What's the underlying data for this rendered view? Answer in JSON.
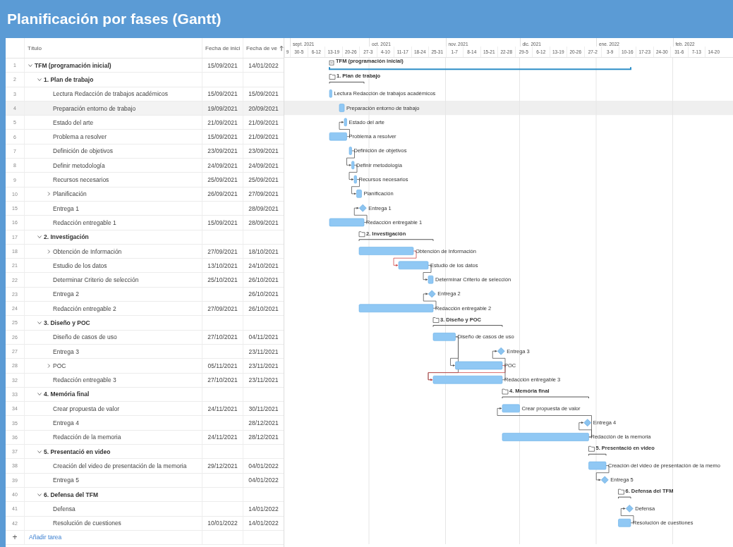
{
  "window": {
    "title": "Planificación por fases (Gantt)"
  },
  "table": {
    "columns": [
      {
        "label": "Título"
      },
      {
        "label": "Fecha de inici"
      },
      {
        "label": "Fecha de ve",
        "sorted": true
      }
    ],
    "rows": [
      {
        "num": "1",
        "title": "TFM (programación inicial)",
        "start": "15/09/2021",
        "end": "14/01/2022",
        "expanded": true,
        "selected": false,
        "children": [
          {
            "num": "2",
            "title": "1. Plan de trabajo",
            "expanded": true,
            "selected": false,
            "children": [
              {
                "num": "3",
                "title": "Lectura Redacción de trabajos académicos",
                "start": "15/09/2021",
                "end": "15/09/2021",
                "selected": false
              },
              {
                "num": "4",
                "title": "Preparación entorno de trabajo",
                "start": "19/09/2021",
                "end": "20/09/2021",
                "selected": true
              },
              {
                "num": "5",
                "title": "Estado del arte",
                "start": "21/09/2021",
                "end": "21/09/2021",
                "selected": false
              },
              {
                "num": "6",
                "title": "Problema a resolver",
                "start": "15/09/2021",
                "end": "21/09/2021",
                "selected": false
              },
              {
                "num": "7",
                "title": "Definición de objetivos",
                "start": "23/09/2021",
                "end": "23/09/2021",
                "selected": false
              },
              {
                "num": "8",
                "title": "Definir metodología",
                "start": "24/09/2021",
                "end": "24/09/2021",
                "selected": false
              },
              {
                "num": "9",
                "title": "Recursos necesarios",
                "start": "25/09/2021",
                "end": "25/09/2021",
                "selected": false
              },
              {
                "num": "10",
                "title": "Planificación",
                "start": "26/09/2021",
                "end": "27/09/2021",
                "expanded": false,
                "selected": false
              },
              {
                "num": "15",
                "title": "Entrega 1",
                "end": "28/09/2021",
                "selected": false
              },
              {
                "num": "16",
                "title": "Redacción entregable 1",
                "start": "15/09/2021",
                "end": "28/09/2021",
                "selected": false
              }
            ]
          },
          {
            "num": "17",
            "title": "2. Investigación",
            "expanded": true,
            "selected": false,
            "children": [
              {
                "num": "18",
                "title": "Obtención de Información",
                "start": "27/09/2021",
                "end": "18/10/2021",
                "expanded": false,
                "selected": false
              },
              {
                "num": "21",
                "title": "Estudio de los datos",
                "start": "13/10/2021",
                "end": "24/10/2021",
                "selected": false
              },
              {
                "num": "22",
                "title": "Determinar Criterio de selección",
                "start": "25/10/2021",
                "end": "26/10/2021",
                "selected": false
              },
              {
                "num": "23",
                "title": "Entrega 2",
                "end": "26/10/2021",
                "selected": false
              },
              {
                "num": "24",
                "title": "Redacción entregable 2",
                "start": "27/09/2021",
                "end": "26/10/2021",
                "selected": false
              }
            ]
          },
          {
            "num": "25",
            "title": "3. Diseño y POC",
            "expanded": true,
            "selected": false,
            "children": [
              {
                "num": "26",
                "title": "Diseño de casos de uso",
                "start": "27/10/2021",
                "end": "04/11/2021",
                "selected": false
              },
              {
                "num": "27",
                "title": "Entrega 3",
                "end": "23/11/2021",
                "selected": false
              },
              {
                "num": "28",
                "title": "POC",
                "start": "05/11/2021",
                "end": "23/11/2021",
                "expanded": false,
                "selected": false
              },
              {
                "num": "32",
                "title": "Redacción entregable 3",
                "start": "27/10/2021",
                "end": "23/11/2021",
                "selected": false
              }
            ]
          },
          {
            "num": "33",
            "title": "4. Memória final",
            "expanded": true,
            "selected": false,
            "children": [
              {
                "num": "34",
                "title": "Crear propuesta de valor",
                "start": "24/11/2021",
                "end": "30/11/2021",
                "selected": false
              },
              {
                "num": "35",
                "title": "Entrega 4",
                "end": "28/12/2021",
                "selected": false
              },
              {
                "num": "36",
                "title": "Redacción de la memoria",
                "start": "24/11/2021",
                "end": "28/12/2021",
                "selected": false
              }
            ]
          },
          {
            "num": "37",
            "title": "5. Presentació en video",
            "expanded": true,
            "selected": false,
            "children": [
              {
                "num": "38",
                "title": "Creación del video de presentación de la memoria",
                "start": "29/12/2021",
                "end": "04/01/2022",
                "selected": false
              },
              {
                "num": "39",
                "title": "Entrega 5",
                "end": "04/01/2022",
                "selected": false
              }
            ]
          },
          {
            "num": "40",
            "title": "6. Defensa del TFM",
            "expanded": true,
            "selected": false,
            "children": [
              {
                "num": "41",
                "title": "Defensa",
                "end": "14/01/2022",
                "selected": false
              },
              {
                "num": "42",
                "title": "Resolución de cuestiones",
                "start": "10/01/2022",
                "end": "14/01/2022",
                "selected": false
              }
            ]
          }
        ]
      }
    ],
    "add_task": {
      "icon": "+",
      "label": "Añadir tarea"
    }
  },
  "gantt": {
    "months": [
      "sept. 2021",
      "oct. 2021",
      "nov. 2021",
      "dic. 2021",
      "ene. 2022",
      "feb. 2022"
    ],
    "weeks": [
      "9",
      "30-5",
      "6-12",
      "13-19",
      "20-26",
      "27-3",
      "4-10",
      "11-17",
      "18-24",
      "25-31",
      "1-7",
      "8-14",
      "15-21",
      "22-28",
      "29-5",
      "6-12",
      "13-19",
      "20-26",
      "27-2",
      "3-9",
      "10-16",
      "17-23",
      "24-30",
      "31-6",
      "7-13",
      "14-20"
    ],
    "bars": [
      {
        "label": "TFM (programación inicial)",
        "kind": "summary"
      },
      {
        "label": "1. Plan de trabajo",
        "kind": "group"
      },
      {
        "label": "Lectura Redacción de trabajos académicos",
        "kind": "task"
      },
      {
        "label": "Preparación entorno de trabajo",
        "kind": "task"
      },
      {
        "label": "Estado del arte",
        "kind": "task"
      },
      {
        "label": "Problema a resolver",
        "kind": "task"
      },
      {
        "label": "Definición de objetivos",
        "kind": "task"
      },
      {
        "label": "Definir metodología",
        "kind": "task"
      },
      {
        "label": "Recursos necesarios",
        "kind": "task"
      },
      {
        "label": "Planificación",
        "kind": "task"
      },
      {
        "label": "Entrega 1",
        "kind": "milestone"
      },
      {
        "label": "Redacción entregable 1",
        "kind": "task"
      },
      {
        "label": "2. Investigación",
        "kind": "group"
      },
      {
        "label": "Obtención de Información",
        "kind": "task"
      },
      {
        "label": "Estudio de los datos",
        "kind": "task"
      },
      {
        "label": "Determinar Criterio de selección",
        "kind": "task"
      },
      {
        "label": "Entrega 2",
        "kind": "milestone"
      },
      {
        "label": "Redacción entregable 2",
        "kind": "task"
      },
      {
        "label": "3. Diseño y POC",
        "kind": "group"
      },
      {
        "label": "Diseño de casos de uso",
        "kind": "task"
      },
      {
        "label": "Entrega 3",
        "kind": "milestone"
      },
      {
        "label": "POC",
        "kind": "task"
      },
      {
        "label": "Redacción entregable 3",
        "kind": "task"
      },
      {
        "label": "4. Memória final",
        "kind": "group"
      },
      {
        "label": "Crear propuesta de valor",
        "kind": "task"
      },
      {
        "label": "Entrega 4",
        "kind": "milestone"
      },
      {
        "label": "Redacción de la memoria",
        "kind": "task"
      },
      {
        "label": "5. Presentació en video",
        "kind": "group"
      },
      {
        "label": "Creación del video de presentación de la memo",
        "kind": "task"
      },
      {
        "label": "Entrega 5",
        "kind": "milestone"
      },
      {
        "label": "6. Defensa del TFM",
        "kind": "group"
      },
      {
        "label": "Defensa",
        "kind": "milestone"
      },
      {
        "label": "Resolución de cuestiones",
        "kind": "task"
      }
    ]
  }
}
